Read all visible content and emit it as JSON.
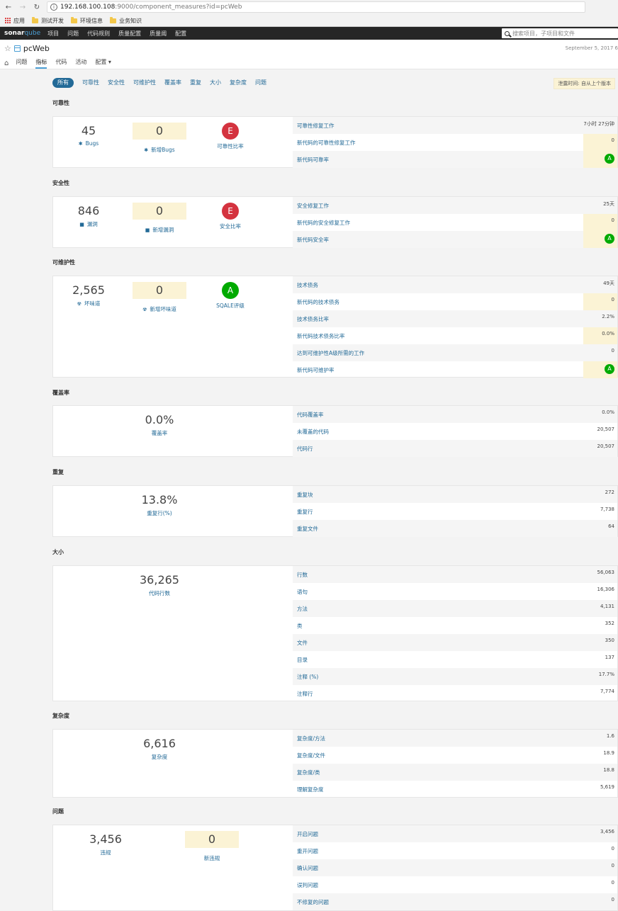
{
  "browser": {
    "url_host": "192.168.100.108",
    "url_path": ":9000/component_measures?id=pcWeb",
    "bookmarks": [
      "应用",
      "测试开发",
      "环境信息",
      "业务知识"
    ]
  },
  "topnav": {
    "logo_main": "sonar",
    "logo_sub": "qube",
    "items": [
      "项目",
      "问题",
      "代码规则",
      "质量配置",
      "质量阈",
      "配置"
    ],
    "search_placeholder": "搜索项目，子项目和文件"
  },
  "project": {
    "name": "pcWeb",
    "date": "September 5, 2017 6",
    "tabs": [
      "问题",
      "指标",
      "代码",
      "活动",
      "配置"
    ]
  },
  "domain_tabs": [
    "所有",
    "可靠性",
    "安全性",
    "可维护性",
    "覆盖率",
    "重复",
    "大小",
    "复杂度",
    "问题"
  ],
  "leak_label": "泄露时间: 自从上个版本",
  "colors": {
    "accent": "#236a97",
    "leak_bg": "#fbf3d5",
    "rating_e": "#d4333f",
    "rating_a": "#00aa00"
  },
  "reliability": {
    "title": "可靠性",
    "bugs_value": "45",
    "bugs_label": "Bugs",
    "new_bugs_value": "0",
    "new_bugs_label": "新增Bugs",
    "rating_value": "E",
    "rating_label": "可靠性比率",
    "rows": [
      {
        "label": "可靠性修复工作",
        "value": "7小时 27分钟"
      },
      {
        "label": "新代码的可靠性修复工作",
        "value": "0"
      },
      {
        "label": "新代码可靠率",
        "value": "A"
      }
    ]
  },
  "security": {
    "title": "安全性",
    "vuln_value": "846",
    "vuln_label": "漏洞",
    "new_vuln_value": "0",
    "new_vuln_label": "新增漏洞",
    "rating_value": "E",
    "rating_label": "安全比率",
    "rows": [
      {
        "label": "安全修复工作",
        "value": "25天"
      },
      {
        "label": "新代码的安全修复工作",
        "value": "0"
      },
      {
        "label": "新代码安全率",
        "value": "A"
      }
    ]
  },
  "maintainability": {
    "title": "可维护性",
    "smells_value": "2,565",
    "smells_label": "坏味道",
    "new_smells_value": "0",
    "new_smells_label": "新增坏味道",
    "rating_value": "A",
    "rating_label": "SQALE评级",
    "rows": [
      {
        "label": "技术债务",
        "value": "49天"
      },
      {
        "label": "新代码的技术债务",
        "value": "0"
      },
      {
        "label": "技术债务比率",
        "value": "2.2%"
      },
      {
        "label": "新代码技术债务比率",
        "value": "0.0%"
      },
      {
        "label": "达到可维护性A级所需的工作",
        "value": "0"
      },
      {
        "label": "新代码可维护率",
        "value": "A"
      }
    ]
  },
  "coverage": {
    "title": "覆盖率",
    "value": "0.0%",
    "label": "覆盖率",
    "rows": [
      {
        "label": "代码覆盖率",
        "value": "0.0%"
      },
      {
        "label": "未覆盖的代码",
        "value": "20,507"
      },
      {
        "label": "代码行",
        "value": "20,507"
      }
    ]
  },
  "duplications": {
    "title": "重复",
    "value": "13.8%",
    "label": "重复行(%)",
    "rows": [
      {
        "label": "重复块",
        "value": "272"
      },
      {
        "label": "重复行",
        "value": "7,738"
      },
      {
        "label": "重复文件",
        "value": "64"
      }
    ]
  },
  "size": {
    "title": "大小",
    "value": "36,265",
    "label": "代码行数",
    "rows": [
      {
        "label": "行数",
        "value": "56,063"
      },
      {
        "label": "语句",
        "value": "16,306"
      },
      {
        "label": "方法",
        "value": "4,131"
      },
      {
        "label": "类",
        "value": "352"
      },
      {
        "label": "文件",
        "value": "350"
      },
      {
        "label": "目录",
        "value": "137"
      },
      {
        "label": "注释 (%)",
        "value": "17.7%"
      },
      {
        "label": "注释行",
        "value": "7,774"
      }
    ]
  },
  "complexity": {
    "title": "复杂度",
    "value": "6,616",
    "label": "复杂度",
    "rows": [
      {
        "label": "复杂度/方法",
        "value": "1.6"
      },
      {
        "label": "复杂度/文件",
        "value": "18.9"
      },
      {
        "label": "复杂度/类",
        "value": "18.8"
      },
      {
        "label": "理解复杂度",
        "value": "5,619"
      }
    ]
  },
  "issues": {
    "title": "问题",
    "violations_value": "3,456",
    "violations_label": "违规",
    "new_violations_value": "0",
    "new_violations_label": "新违规",
    "rows": [
      {
        "label": "开启问题",
        "value": "3,456"
      },
      {
        "label": "重开问题",
        "value": "0"
      },
      {
        "label": "确认问题",
        "value": "0"
      },
      {
        "label": "误判问题",
        "value": "0"
      },
      {
        "label": "不修复的问题",
        "value": "0"
      }
    ]
  }
}
